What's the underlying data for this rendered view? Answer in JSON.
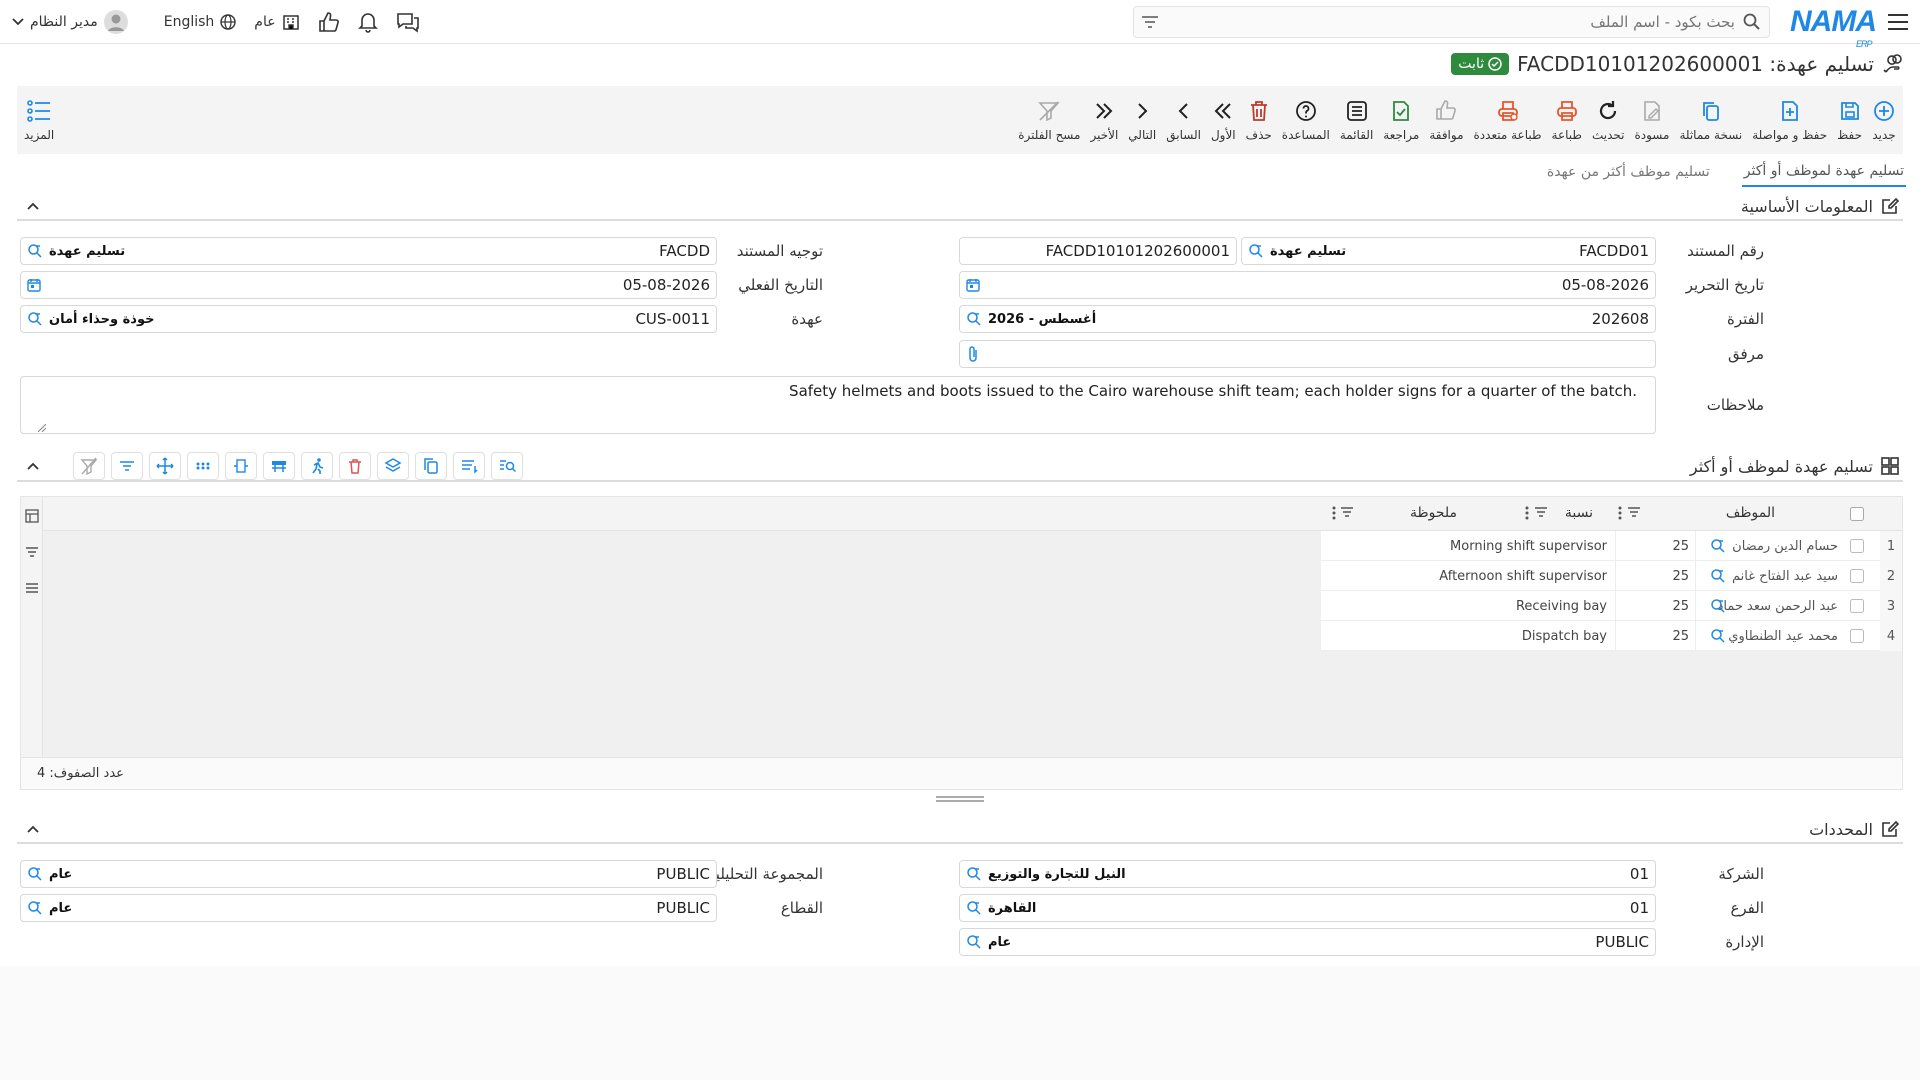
{
  "topbar": {
    "search_placeholder": "بحث بكود - اسم الملف",
    "user": "مدير النظام",
    "language": "English",
    "scope": "عام",
    "logo": "NAMA",
    "logo_sub": "ERP"
  },
  "title": {
    "text": "تسليم عهدة: FACDD10101202600001",
    "badge": "ثابت"
  },
  "toolbar": {
    "buttons": [
      {
        "label": "جديد",
        "icon": "plus-circle-icon",
        "color": "#1e88e5"
      },
      {
        "label": "حفظ",
        "icon": "save-icon",
        "color": "#1e88e5"
      },
      {
        "label": "حفظ و مواصلة",
        "icon": "save-continue-icon",
        "color": "#1e88e5"
      },
      {
        "label": "نسخة مماثلة",
        "icon": "copy-icon",
        "color": "#1e88e5"
      },
      {
        "label": "مسودة",
        "icon": "draft-icon",
        "color": "#aaaaaa"
      },
      {
        "label": "تحديث",
        "icon": "refresh-icon",
        "color": "#222222"
      },
      {
        "label": "طباعة",
        "icon": "print-icon",
        "color": "#e8552d"
      },
      {
        "label": "طباعة متعددة",
        "icon": "multi-print-icon",
        "color": "#e8552d"
      },
      {
        "label": "موافقة",
        "icon": "thumbs-up-icon",
        "color": "#aaaaaa"
      },
      {
        "label": "مراجعة",
        "icon": "review-icon",
        "color": "#2e8b3e"
      },
      {
        "label": "القائمة",
        "icon": "list-icon",
        "color": "#222222"
      },
      {
        "label": "المساعدة",
        "icon": "help-icon",
        "color": "#222222"
      },
      {
        "label": "حذف",
        "icon": "delete-icon",
        "color": "#c0392b"
      },
      {
        "label": "الأول",
        "icon": "first-icon",
        "color": "#222222"
      },
      {
        "label": "السابق",
        "icon": "prev-icon",
        "color": "#222222"
      },
      {
        "label": "التالي",
        "icon": "next-icon",
        "color": "#222222"
      },
      {
        "label": "الأخير",
        "icon": "last-icon",
        "color": "#222222"
      },
      {
        "label": "مسح الفلترة",
        "icon": "clear-filter-icon",
        "color": "#aaaaaa"
      }
    ],
    "more": "المزيد"
  },
  "tabs": [
    "تسليم عهدة لموظف أو أكثر",
    "تسليم موظف أكثر من عهدة"
  ],
  "basic": {
    "title": "المعلومات الأساسية",
    "doc_number_label": "رقم المستند",
    "doc_prefix": "FACDD01",
    "doc_type": "تسليم عهدة",
    "doc_code": "FACDD10101202600001",
    "doc_direction_label": "توجيه المستند",
    "direction_code": "FACDD",
    "direction_name": "تسليم عهدة",
    "edit_date_label": "تاريخ التحرير",
    "edit_date": "05-08-2026",
    "actual_date_label": "التاريخ الفعلي",
    "actual_date": "05-08-2026",
    "period_label": "الفترة",
    "period_code": "202608",
    "period_name": "2026 - أغسطس",
    "custody_label": "عهدة",
    "custody_code": "CUS-0011",
    "custody_name": "خوذة وحذاء أمان",
    "attachment_label": "مرفق",
    "notes_label": "ملاحظات",
    "notes": "Safety helmets and boots issued to the Cairo warehouse shift team; each holder signs for a quarter of the batch."
  },
  "grid": {
    "title": "تسليم عهدة لموظف أو أكثر",
    "columns": {
      "employee": "الموظف",
      "ratio": "نسبة",
      "note": "ملحوظة"
    },
    "rows": [
      {
        "n": "1",
        "employee": "حسام الدين رمضان",
        "ratio": "25",
        "note": "Morning shift supervisor"
      },
      {
        "n": "2",
        "employee": "سيد عبد الفتاح غانم",
        "ratio": "25",
        "note": "Afternoon shift supervisor"
      },
      {
        "n": "3",
        "employee": "عبد الرحمن سعد حماد",
        "ratio": "25",
        "note": "Receiving bay"
      },
      {
        "n": "4",
        "employee": "محمد عيد الطنطاوي",
        "ratio": "25",
        "note": "Dispatch bay"
      }
    ],
    "row_count": "عدد الصفوف: 4"
  },
  "dims": {
    "title": "المحددات",
    "company_label": "الشركة",
    "company_code": "01",
    "company_name": "النيل للتجارة والتوزيع",
    "branch_label": "الفرع",
    "branch_code": "01",
    "branch_name": "القاهرة",
    "dept_label": "الإدارة",
    "dept_code": "PUBLIC",
    "dept_name": "عام",
    "analytic_label": "المجموعة التحليلية",
    "analytic_code": "PUBLIC",
    "analytic_name": "عام",
    "sector_label": "القطاع",
    "sector_code": "PUBLIC",
    "sector_name": "عام"
  }
}
